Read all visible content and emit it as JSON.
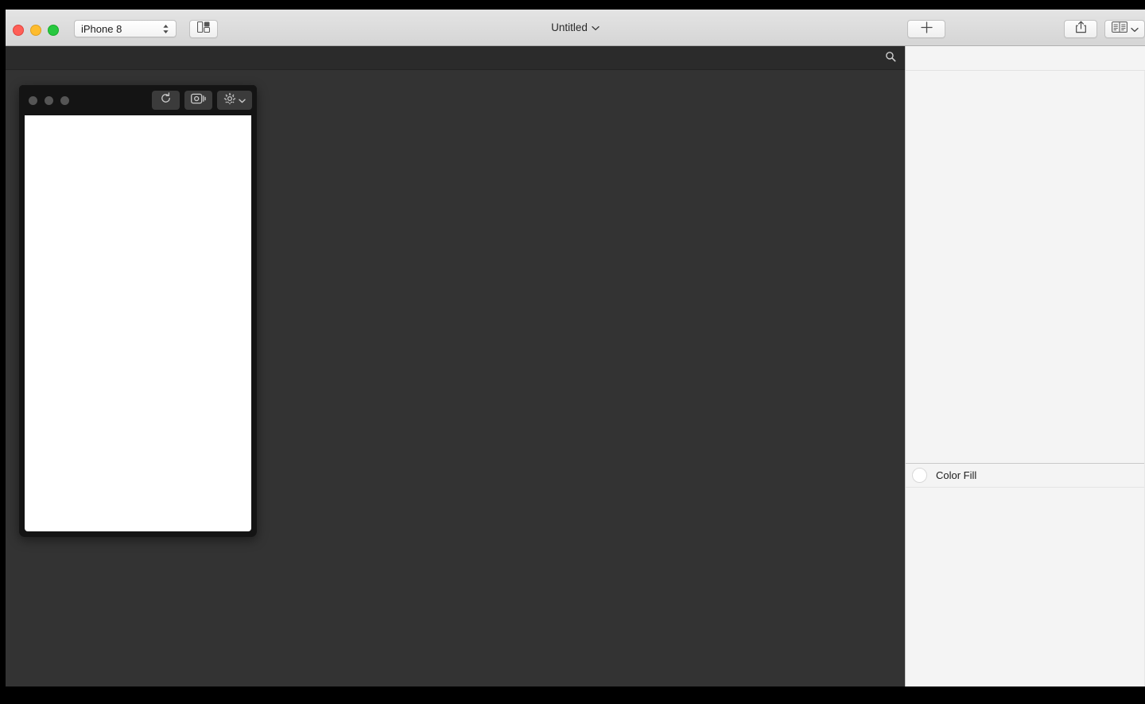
{
  "window": {
    "title": "Untitled",
    "title_chevron_icon": "chevron-down-icon"
  },
  "titlebar": {
    "traffic_lights": [
      {
        "name": "close",
        "color": "#ff5f57"
      },
      {
        "name": "minimize",
        "color": "#febc2e"
      },
      {
        "name": "maximize",
        "color": "#28c840"
      }
    ],
    "device_popup": {
      "value": "iPhone 8",
      "stepper_icon": "up-down-stepper-icon"
    },
    "layout_button": {
      "icon": "split-layout-icon"
    },
    "add_button": {
      "icon": "plus-icon"
    },
    "share_button": {
      "icon": "share-icon"
    },
    "library_button": {
      "icon": "library-book-icon",
      "chevron_icon": "chevron-down-icon"
    }
  },
  "canvas_toolbar": {
    "search_icon": "search-icon"
  },
  "device_window": {
    "dots": [
      "dot-1",
      "dot-2",
      "dot-3"
    ],
    "reload_button": {
      "icon": "reload-icon"
    },
    "record_button": {
      "icon": "screen-record-icon"
    },
    "settings_button": {
      "icon": "gear-icon",
      "chevron_icon": "chevron-down-icon"
    },
    "screen_background": "#ffffff"
  },
  "inspector": {
    "layers": [
      {
        "name": "color-fill",
        "label": "Color Fill",
        "swatch_color": "#ffffff"
      }
    ]
  },
  "colors": {
    "canvas_background": "#333333",
    "canvas_toolbar": "#2b2b2b",
    "panel_background": "#f4f4f4",
    "titlebar_background": "#dcdcdc"
  }
}
